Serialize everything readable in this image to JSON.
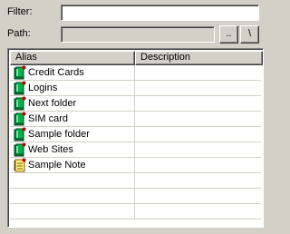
{
  "filter": {
    "label": "Filter:",
    "value": ""
  },
  "path": {
    "label": "Path:",
    "value": "",
    "up_button": "..",
    "root_button": "\\"
  },
  "list": {
    "columns": [
      "Alias",
      "Description"
    ],
    "rows": [
      {
        "alias": "Credit Cards",
        "description": "",
        "icon": "green-folder-icon"
      },
      {
        "alias": "Logins",
        "description": "",
        "icon": "green-folder-icon"
      },
      {
        "alias": "Next folder",
        "description": "",
        "icon": "green-folder-icon"
      },
      {
        "alias": "SIM card",
        "description": "",
        "icon": "green-folder-icon"
      },
      {
        "alias": "Sample folder",
        "description": "",
        "icon": "green-folder-icon"
      },
      {
        "alias": "Web Sites",
        "description": "",
        "icon": "green-folder-icon"
      },
      {
        "alias": "Sample Note",
        "description": "",
        "icon": "note-icon"
      }
    ]
  },
  "colors": {
    "window_bg": "#d4d0c8",
    "folder_green": "#00a040",
    "note_yellow": "#fff080",
    "accent_red": "#c00000"
  }
}
